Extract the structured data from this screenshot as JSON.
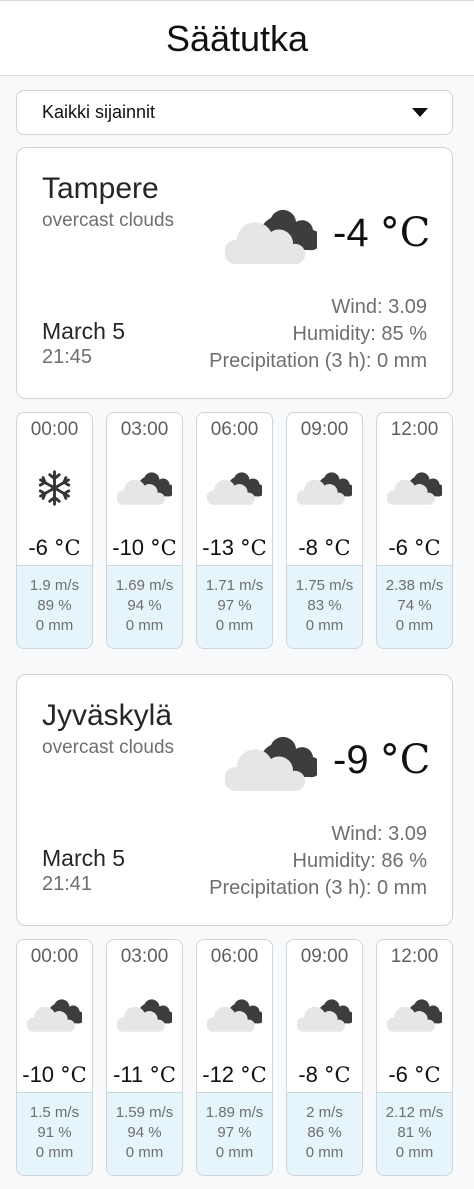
{
  "app": {
    "title": "Säätutka"
  },
  "filter": {
    "selected": "Kaikki sijainnit"
  },
  "locations": [
    {
      "city": "Tampere",
      "description": "overcast clouds",
      "icon": "overcast-clouds-icon",
      "temp": "-4",
      "unit": "°C",
      "date": "March 5",
      "time": "21:45",
      "wind": "Wind: 3.09",
      "humidity": "Humidity: 85 %",
      "precipitation": "Precipitation (3 h): 0 mm",
      "forecast": [
        {
          "hour": "00:00",
          "icon": "snowflake-icon",
          "temp": "-6",
          "unit": "°C",
          "wind": "1.9 m/s",
          "humidity": "89 %",
          "precip": "0 mm"
        },
        {
          "hour": "03:00",
          "icon": "overcast-clouds-icon",
          "temp": "-10",
          "unit": "°C",
          "wind": "1.69 m/s",
          "humidity": "94 %",
          "precip": "0 mm"
        },
        {
          "hour": "06:00",
          "icon": "overcast-clouds-icon",
          "temp": "-13",
          "unit": "°C",
          "wind": "1.71 m/s",
          "humidity": "97 %",
          "precip": "0 mm"
        },
        {
          "hour": "09:00",
          "icon": "overcast-clouds-icon",
          "temp": "-8",
          "unit": "°C",
          "wind": "1.75 m/s",
          "humidity": "83 %",
          "precip": "0 mm"
        },
        {
          "hour": "12:00",
          "icon": "overcast-clouds-icon",
          "temp": "-6",
          "unit": "°C",
          "wind": "2.38 m/s",
          "humidity": "74 %",
          "precip": "0 mm"
        }
      ]
    },
    {
      "city": "Jyväskylä",
      "description": "overcast clouds",
      "icon": "overcast-clouds-icon",
      "temp": "-9",
      "unit": "°C",
      "date": "March 5",
      "time": "21:41",
      "wind": "Wind: 3.09",
      "humidity": "Humidity: 86 %",
      "precipitation": "Precipitation (3 h): 0 mm",
      "forecast": [
        {
          "hour": "00:00",
          "icon": "overcast-clouds-icon",
          "temp": "-10",
          "unit": "°C",
          "wind": "1.5 m/s",
          "humidity": "91 %",
          "precip": "0 mm"
        },
        {
          "hour": "03:00",
          "icon": "overcast-clouds-icon",
          "temp": "-11",
          "unit": "°C",
          "wind": "1.59 m/s",
          "humidity": "94 %",
          "precip": "0 mm"
        },
        {
          "hour": "06:00",
          "icon": "overcast-clouds-icon",
          "temp": "-12",
          "unit": "°C",
          "wind": "1.89 m/s",
          "humidity": "97 %",
          "precip": "0 mm"
        },
        {
          "hour": "09:00",
          "icon": "overcast-clouds-icon",
          "temp": "-8",
          "unit": "°C",
          "wind": "2 m/s",
          "humidity": "86 %",
          "precip": "0 mm"
        },
        {
          "hour": "12:00",
          "icon": "overcast-clouds-icon",
          "temp": "-6",
          "unit": "°C",
          "wind": "2.12 m/s",
          "humidity": "81 %",
          "precip": "0 mm"
        }
      ]
    }
  ]
}
